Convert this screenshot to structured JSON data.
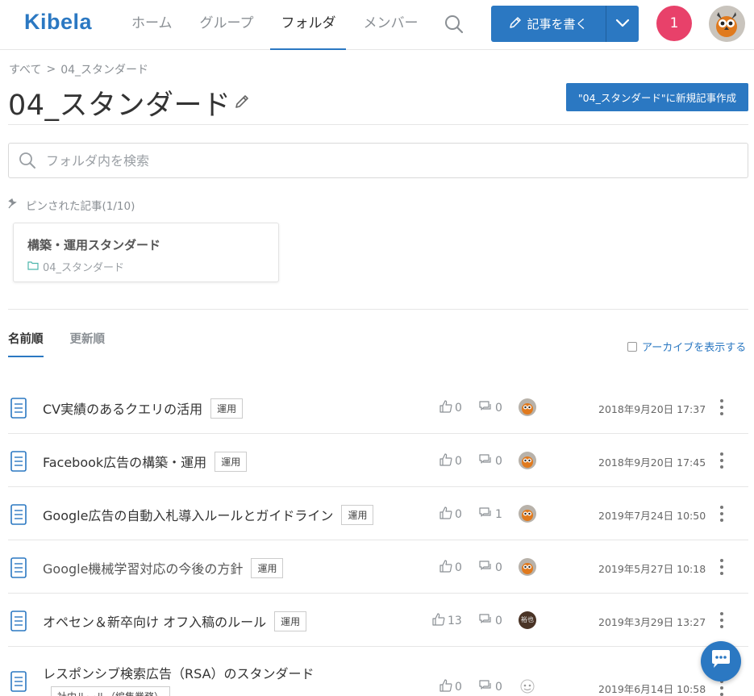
{
  "header": {
    "logo": "Kibela",
    "nav": [
      {
        "label": "ホーム"
      },
      {
        "label": "グループ"
      },
      {
        "label": "フォルダ"
      },
      {
        "label": "メンバー"
      }
    ],
    "active_nav": "フォルダ",
    "write_label": "記事を書く",
    "notification_count": "1"
  },
  "breadcrumb": {
    "root": "すべて",
    "separator": ">",
    "current": "04_スタンダード"
  },
  "page": {
    "title": "04_スタンダード",
    "new_post_label": "\"04_スタンダード\"に新規記事作成"
  },
  "folder_search": {
    "placeholder": "フォルダ内を検索"
  },
  "pinned": {
    "label": "ピンされた記事(1/10)",
    "card": {
      "title": "構築・運用スタンダード",
      "folder": "04_スタンダード"
    }
  },
  "sort": {
    "tabs": [
      {
        "label": "名前順"
      },
      {
        "label": "更新順"
      }
    ],
    "active": "名前順",
    "archive_label": "アーカイブを表示する"
  },
  "articles": [
    {
      "title": "CV実績のあるクエリの活用",
      "tag": "運用",
      "likes": "0",
      "comments": "0",
      "date": "2018年9月20日 17:37",
      "avatar": "owl"
    },
    {
      "title": "Facebook広告の構築・運用",
      "tag": "運用",
      "likes": "0",
      "comments": "0",
      "date": "2018年9月20日 17:45",
      "avatar": "owl"
    },
    {
      "title": "Google広告の自動入札導入ルールとガイドライン",
      "tag": "運用",
      "likes": "0",
      "comments": "1",
      "date": "2019年7月24日 10:50",
      "avatar": "owl"
    },
    {
      "title": "Google機械学習対応の今後の方針",
      "tag": "運用",
      "likes": "0",
      "comments": "0",
      "date": "2019年5月27日 10:18",
      "avatar": "owl"
    },
    {
      "title": "オペセン＆新卒向け オフ入稿のルール",
      "tag": "運用",
      "likes": "13",
      "comments": "0",
      "date": "2019年3月29日 13:27",
      "avatar": "person",
      "avatar_text": "裕也"
    },
    {
      "title": "レスポンシブ検索広告（RSA）のスタンダード",
      "tag": "社内ルール（編集業務）",
      "likes": "0",
      "comments": "0",
      "date": "2019年6月14日 10:58",
      "avatar": "face"
    }
  ],
  "colors": {
    "brand": "#2b78c2",
    "notification": "#e8416a"
  }
}
